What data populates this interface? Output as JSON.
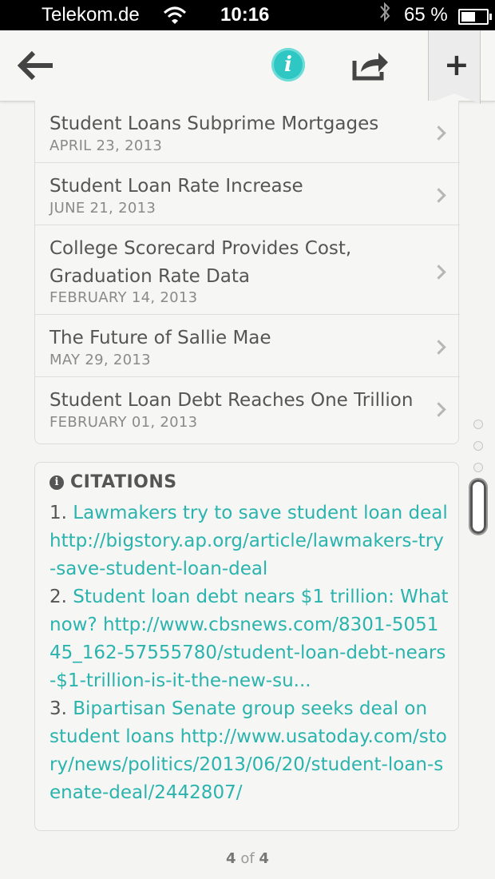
{
  "status_bar": {
    "carrier": "Telekom.de",
    "time": "10:16",
    "battery": "65 %",
    "battery_level": 0.65
  },
  "toolbar": {
    "back_icon": "arrow-left-icon",
    "info_icon": "info-icon",
    "share_icon": "share-icon",
    "add_icon": "plus-icon",
    "info_glyph": "i",
    "add_glyph": "+"
  },
  "related": [
    {
      "title": "Student Loans Subprime Mortgages",
      "date": "APRIL 23, 2013"
    },
    {
      "title": "Student Loan Rate Increase",
      "date": "JUNE 21, 2013"
    },
    {
      "title": "College Scorecard Provides Cost, Graduation Rate Data",
      "date": "FEBRUARY 14, 2013"
    },
    {
      "title": "The Future of Sallie Mae",
      "date": "MAY 29, 2013"
    },
    {
      "title": "Student Loan Debt Reaches One Trillion",
      "date": "FEBRUARY 01, 2013"
    }
  ],
  "citations": {
    "title": "CITATIONS",
    "items": [
      {
        "num": "1.",
        "link": "Lawmakers try to save student loan deal",
        "url": "http://bigstory.ap.org/article/lawmakers-try-save-student-loan-deal"
      },
      {
        "num": "2.",
        "link": "Student loan debt nears $1 trillion: What now?",
        "url": "http://www.cbsnews.com/8301-505145_162-57555780/student-loan-debt-nears-$1-trillion-is-it-the-new-su..."
      },
      {
        "num": "3.",
        "link": "Bipartisan Senate group seeks deal on student loans",
        "url": "http://www.usatoday.com/story/news/politics/2013/06/20/student-loan-senate-deal/2442807/"
      }
    ]
  },
  "pager": {
    "current": "4",
    "of": "of",
    "total": "4"
  },
  "colors": {
    "accent": "#2bb3ae",
    "info_button": "#2ec7c4"
  }
}
